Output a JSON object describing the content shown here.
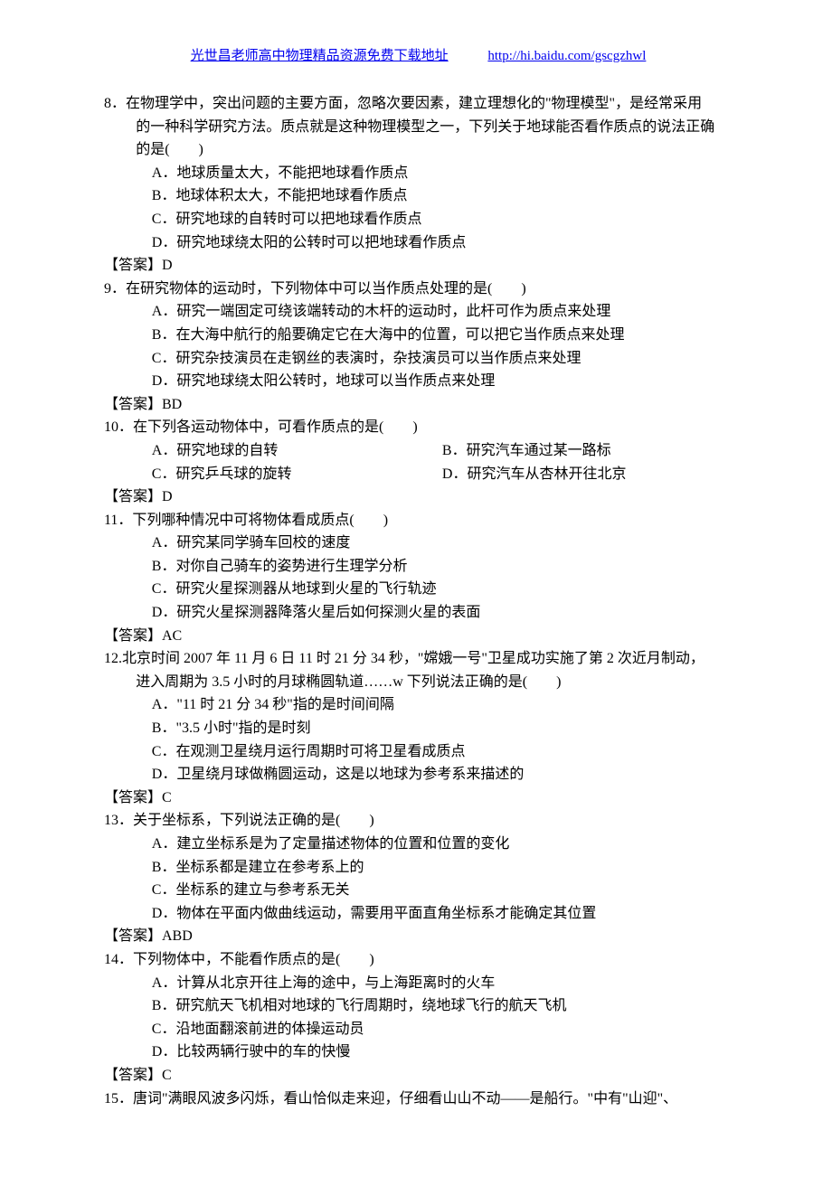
{
  "header": {
    "title": "光世昌老师高中物理精品资源免费下载地址",
    "url": "http://hi.baidu.com/gscgzhwl"
  },
  "questions": [
    {
      "num": "8",
      "stem_lines": [
        "8．在物理学中，突出问题的主要方面，忽略次要因素，建立理想化的\"物理模型\"，是经常采用",
        "的一种科学研究方法。质点就是这种物理模型之一，下列关于地球能否看作质点的说法正确",
        "的是(　　)"
      ],
      "stem_indent": [
        0,
        1,
        1
      ],
      "options": [
        "A．地球质量太大，不能把地球看作质点",
        "B．地球体积太大，不能把地球看作质点",
        "C．研究地球的自转时可以把地球看作质点",
        "D．研究地球绕太阳的公转时可以把地球看作质点"
      ],
      "answer": "【答案】D"
    },
    {
      "num": "9",
      "stem_lines": [
        "9．在研究物体的运动时，下列物体中可以当作质点处理的是(　　)"
      ],
      "stem_indent": [
        0
      ],
      "options": [
        "A．研究一端固定可绕该端转动的木杆的运动时，此杆可作为质点来处理",
        "B．在大海中航行的船要确定它在大海中的位置，可以把它当作质点来处理",
        "C．研究杂技演员在走钢丝的表演时，杂技演员可以当作质点来处理",
        "D．研究地球绕太阳公转时，地球可以当作质点来处理"
      ],
      "answer": "【答案】BD"
    },
    {
      "num": "10",
      "stem_lines": [
        "10．在下列各运动物体中，可看作质点的是(　　)"
      ],
      "stem_indent": [
        0
      ],
      "options_2col": [
        {
          "left": "A．研究地球的自转",
          "right": "B．研究汽车通过某一路标"
        },
        {
          "left": "C．研究乒乓球的旋转",
          "right": "D．研究汽车从杏林开往北京"
        }
      ],
      "answer": "【答案】D"
    },
    {
      "num": "11",
      "stem_lines": [
        "11．下列哪种情况中可将物体看成质点(　　)"
      ],
      "stem_indent": [
        0
      ],
      "options": [
        "A．研究某同学骑车回校的速度",
        "B．对你自己骑车的姿势进行生理学分析",
        "C．研究火星探测器从地球到火星的飞行轨迹",
        "D．研究火星探测器降落火星后如何探测火星的表面"
      ],
      "answer": "【答案】AC"
    },
    {
      "num": "12",
      "stem_lines": [
        "12.北京时间 2007 年 11 月 6 日 11 时 21 分 34 秒，\"嫦娥一号\"卫星成功实施了第 2 次近月制动，",
        "进入周期为 3.5 小时的月球椭圆轨道……w 下列说法正确的是(　　)"
      ],
      "stem_indent": [
        0,
        1
      ],
      "options": [
        "A．\"11 时 21 分 34 秒\"指的是时间间隔",
        "B．\"3.5 小时\"指的是时刻",
        "C．在观测卫星绕月运行周期时可将卫星看成质点",
        "D．卫星绕月球做椭圆运动，这是以地球为参考系来描述的"
      ],
      "answer": "【答案】C"
    },
    {
      "num": "13",
      "stem_lines": [
        "13．关于坐标系，下列说法正确的是(　　)"
      ],
      "stem_indent": [
        0
      ],
      "options": [
        "A．建立坐标系是为了定量描述物体的位置和位置的变化",
        "B．坐标系都是建立在参考系上的",
        "C．坐标系的建立与参考系无关",
        "D．物体在平面内做曲线运动，需要用平面直角坐标系才能确定其位置"
      ],
      "answer": "【答案】ABD"
    },
    {
      "num": "14",
      "stem_lines": [
        "14．下列物体中，不能看作质点的是(　　)"
      ],
      "stem_indent": [
        0
      ],
      "options": [
        "A．计算从北京开往上海的途中，与上海距离时的火车",
        "B．研究航天飞机相对地球的飞行周期时，绕地球飞行的航天飞机",
        "C．沿地面翻滚前进的体操运动员",
        "D．比较两辆行驶中的车的快慢"
      ],
      "answer": "【答案】C"
    },
    {
      "num": "15",
      "stem_lines": [
        "15．唐词\"满眼风波多闪烁，看山恰似走来迎，仔细看山山不动——是船行。\"中有\"山迎\"、"
      ],
      "stem_indent": [
        0
      ]
    }
  ]
}
